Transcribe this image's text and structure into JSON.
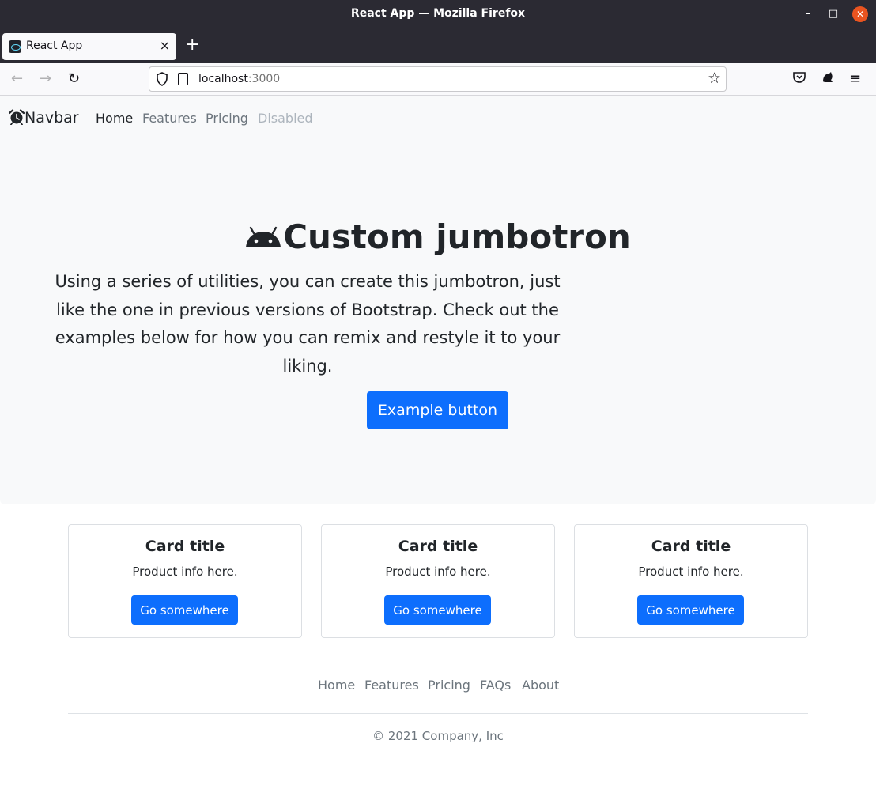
{
  "window": {
    "title": "React App — Mozilla Firefox",
    "controls": {
      "minimize": "–",
      "maximize": "□",
      "close": "✕"
    }
  },
  "tabs": [
    {
      "label": "React App",
      "close": "×",
      "active": true
    }
  ],
  "new_tab_label": "+",
  "toolbar": {
    "back": "←",
    "forward": "→",
    "reload": "↻",
    "url_host": "localhost",
    "url_port": ":3000",
    "bookmark": "☆",
    "pocket": "▿",
    "menu": "≡"
  },
  "navbar": {
    "brand": "Navbar",
    "brand_icon": "alarm-clock-icon",
    "links": [
      {
        "label": "Home",
        "state": "active"
      },
      {
        "label": "Features",
        "state": "normal"
      },
      {
        "label": "Pricing",
        "state": "normal"
      },
      {
        "label": "Disabled",
        "state": "disabled"
      }
    ]
  },
  "jumbotron": {
    "icon": "android-icon",
    "title": "Custom jumbotron",
    "lead": "Using a series of utilities, you can create this jumbotron, just like the one in previous versions of Bootstrap. Check out the examples below for how you can remix and restyle it to your liking.",
    "button": "Example button"
  },
  "cards": [
    {
      "title": "Card title",
      "text": "Product info here.",
      "button": "Go somewhere"
    },
    {
      "title": "Card title",
      "text": "Product info here.",
      "button": "Go somewhere"
    },
    {
      "title": "Card title",
      "text": "Product info here.",
      "button": "Go somewhere"
    }
  ],
  "footer": {
    "links": [
      "Home",
      "Features",
      "Pricing",
      "FAQs",
      "About"
    ],
    "copyright": "© 2021 Company, Inc"
  },
  "colors": {
    "primary": "#0d6efd",
    "jumbotron_bg": "#f8f9fa",
    "muted_text": "#6c757d",
    "chrome_dark": "#2b2a33",
    "close_button": "#e95420"
  }
}
